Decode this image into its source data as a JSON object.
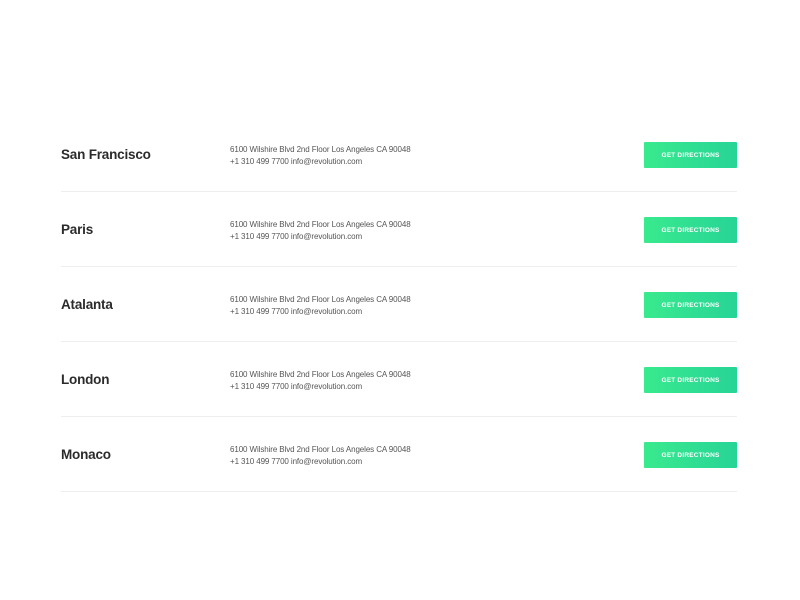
{
  "locations": [
    {
      "city": "San Francisco",
      "address": "6100 Wilshire Blvd 2nd Floor Los Angeles CA 90048",
      "contact": "+1 310 499 7700 info@revolution.com",
      "button_label": "GET DIRECTIONS"
    },
    {
      "city": "Paris",
      "address": "6100 Wilshire Blvd 2nd Floor Los Angeles CA 90048",
      "contact": "+1 310 499 7700 info@revolution.com",
      "button_label": "GET DIRECTIONS"
    },
    {
      "city": "Atalanta",
      "address": "6100 Wilshire Blvd 2nd Floor Los Angeles CA 90048",
      "contact": "+1 310 499 7700 info@revolution.com",
      "button_label": "GET DIRECTIONS"
    },
    {
      "city": "London",
      "address": "6100 Wilshire Blvd 2nd Floor Los Angeles CA 90048",
      "contact": "+1 310 499 7700 info@revolution.com",
      "button_label": "GET DIRECTIONS"
    },
    {
      "city": "Monaco",
      "address": "6100 Wilshire Blvd 2nd Floor Los Angeles CA 90048",
      "contact": "+1 310 499 7700 info@revolution.com",
      "button_label": "GET DIRECTIONS"
    }
  ],
  "colors": {
    "button_gradient_start": "#39ea8e",
    "button_gradient_end": "#27d496",
    "divider": "#eeeeee",
    "city_text": "#2b2b2b",
    "contact_text": "#555555"
  }
}
